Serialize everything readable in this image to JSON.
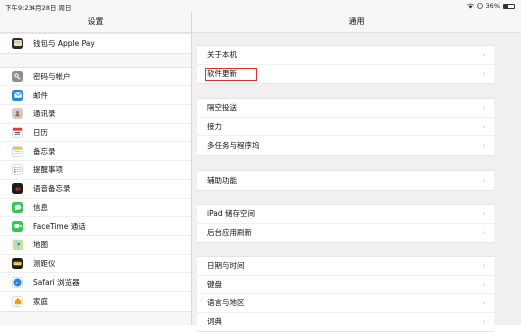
{
  "status": {
    "time": "下午9:23",
    "date": "4月28日 周日",
    "battery": "36%",
    "battery_level": 0.36
  },
  "left_panel": {
    "title": "设置",
    "groups": [
      [
        {
          "label": "钱包与 Apple Pay",
          "icon": "wallet-icon",
          "color": "#2b2b2b"
        }
      ],
      [
        {
          "label": "密码与帐户",
          "icon": "key-icon",
          "color": "#8e8e93"
        },
        {
          "label": "邮件",
          "icon": "mail-icon",
          "color": "#1e88e5"
        },
        {
          "label": "通讯录",
          "icon": "contacts-icon",
          "color": "#a1887f"
        },
        {
          "label": "日历",
          "icon": "calendar-icon",
          "color": "#ffffff"
        },
        {
          "label": "备忘录",
          "icon": "notes-icon",
          "color": "#fbc02d"
        },
        {
          "label": "提醒事项",
          "icon": "reminders-icon",
          "color": "#ffffff"
        },
        {
          "label": "语音备忘录",
          "icon": "voice-memos-icon",
          "color": "#1c1c1c"
        },
        {
          "label": "信息",
          "icon": "messages-icon",
          "color": "#34c759"
        },
        {
          "label": "FaceTime 通话",
          "icon": "facetime-icon",
          "color": "#34c759"
        },
        {
          "label": "地图",
          "icon": "maps-icon",
          "color": "#7cb342"
        },
        {
          "label": "测距仪",
          "icon": "measure-icon",
          "color": "#1c1c1c"
        },
        {
          "label": "Safari 浏览器",
          "icon": "safari-icon",
          "color": "#1e88e5"
        },
        {
          "label": "家庭",
          "icon": "home-icon",
          "color": "#ff9800"
        }
      ]
    ]
  },
  "right_panel": {
    "title": "通用",
    "sections": [
      [
        {
          "label": "关于本机"
        },
        {
          "label": "软件更新"
        }
      ],
      [
        {
          "label": "隔空投送"
        },
        {
          "label": "接力"
        },
        {
          "label": "多任务与程序坞"
        }
      ],
      [
        {
          "label": "辅助功能"
        }
      ],
      [
        {
          "label": "iPad 储存空间"
        },
        {
          "label": "后台应用刷新"
        }
      ],
      [
        {
          "label": "日期与时间"
        },
        {
          "label": "键盘"
        },
        {
          "label": "语言与地区"
        },
        {
          "label": "词典"
        }
      ]
    ]
  }
}
